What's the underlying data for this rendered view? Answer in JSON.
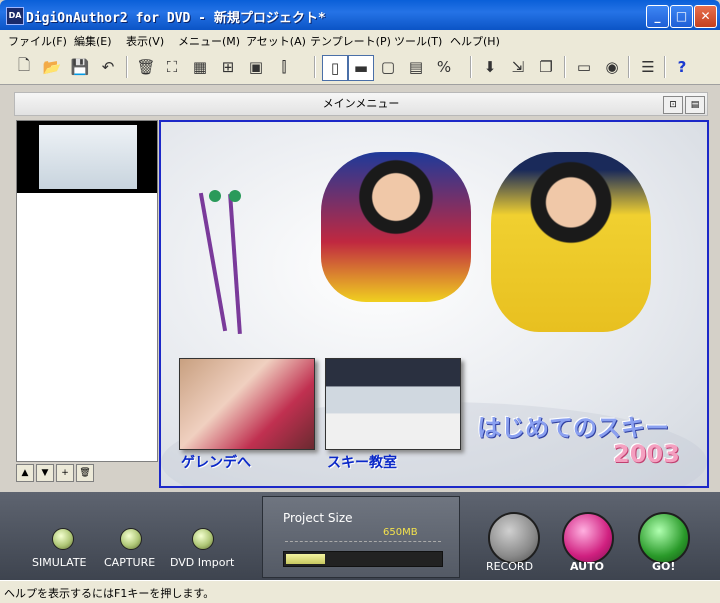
{
  "window": {
    "title": "DigiOnAuthor2 for DVD - 新規プロジェクト*",
    "app_icon": "DA",
    "minimize": "_",
    "maximize": "□",
    "close": "✕"
  },
  "menu": [
    "ファイル(F)",
    "編集(E)",
    "表示(V)",
    "メニュー(M)",
    "アセット(A)",
    "テンプレート(P)",
    "ツール(T)",
    "ヘルプ(H)"
  ],
  "toolbar": {
    "icons": [
      "new-icon",
      "open-icon",
      "save-icon",
      "undo-icon",
      "delete-icon",
      "fit-icon",
      "grid-icon",
      "group-icon",
      "ungroup-icon",
      "align-icon",
      "panel-icon",
      "layout-icon",
      "window-icon",
      "table-icon",
      "percent-icon",
      "down-arrow-icon",
      "import-icon",
      "overlay-icon",
      "frame-icon",
      "record-icon",
      "menu-icon",
      "help-icon"
    ],
    "help_glyph": "?"
  },
  "main_menu": {
    "header": "メインメニュー",
    "thumb_buttons": [
      "▲",
      "▼",
      "+",
      "🗑"
    ],
    "buttons": [
      {
        "label": "ゲレンデへ"
      },
      {
        "label": "スキー教室"
      }
    ],
    "title_text": "はじめてのスキー",
    "year_text": "2003"
  },
  "controls": {
    "simulate": "SIMULATE",
    "capture": "CAPTURE",
    "dvd_import": "DVD Import",
    "project_size_label": "Project Size",
    "capacity_label": "650MB",
    "project_fill": 0.25,
    "record": "RECORD",
    "auto": "AUTO",
    "go": "GO!"
  },
  "status_text": "ヘルプを表示するにはF1キーを押します。",
  "colors": {
    "accent_blue": "#1c28c8",
    "title_bar": "#0a5fd8",
    "auto_button": "#d02080",
    "go_button": "#2a9a2a"
  }
}
